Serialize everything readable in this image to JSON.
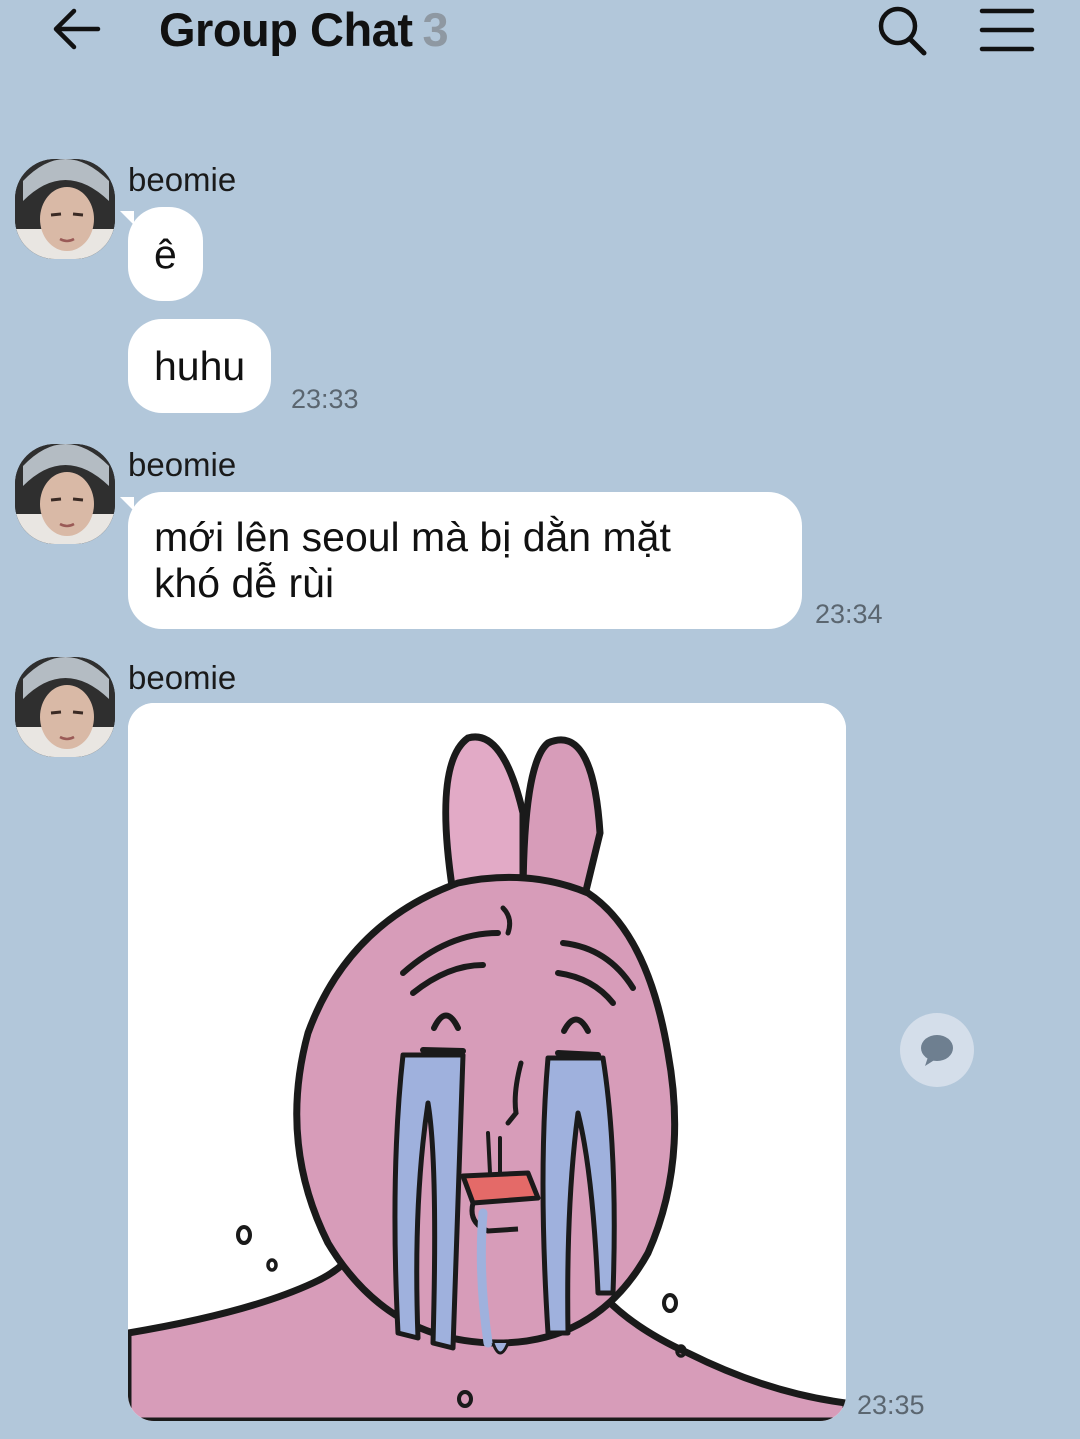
{
  "header": {
    "back_icon": "arrow-left-icon",
    "title": "Group Chat",
    "member_count": "3",
    "search_icon": "search-icon",
    "menu_icon": "hamburger-menu-icon"
  },
  "messages": [
    {
      "sender": "beomie",
      "bubbles": [
        "ê",
        "huhu"
      ],
      "time": "23:33"
    },
    {
      "sender": "beomie",
      "bubbles": [
        "mới lên seoul mà bị dằn mặt",
        "khó dễ rùi"
      ],
      "time": "23:34"
    },
    {
      "sender": "beomie",
      "sticker": "crying-pink-bunny-sticker",
      "time": "23:35"
    }
  ],
  "side_action": {
    "icon": "speech-bubble-icon"
  },
  "colors": {
    "background": "#b2c7da",
    "bubble": "#ffffff",
    "timestamp": "#5b6670",
    "sticker_pink": "#d79cb9"
  }
}
